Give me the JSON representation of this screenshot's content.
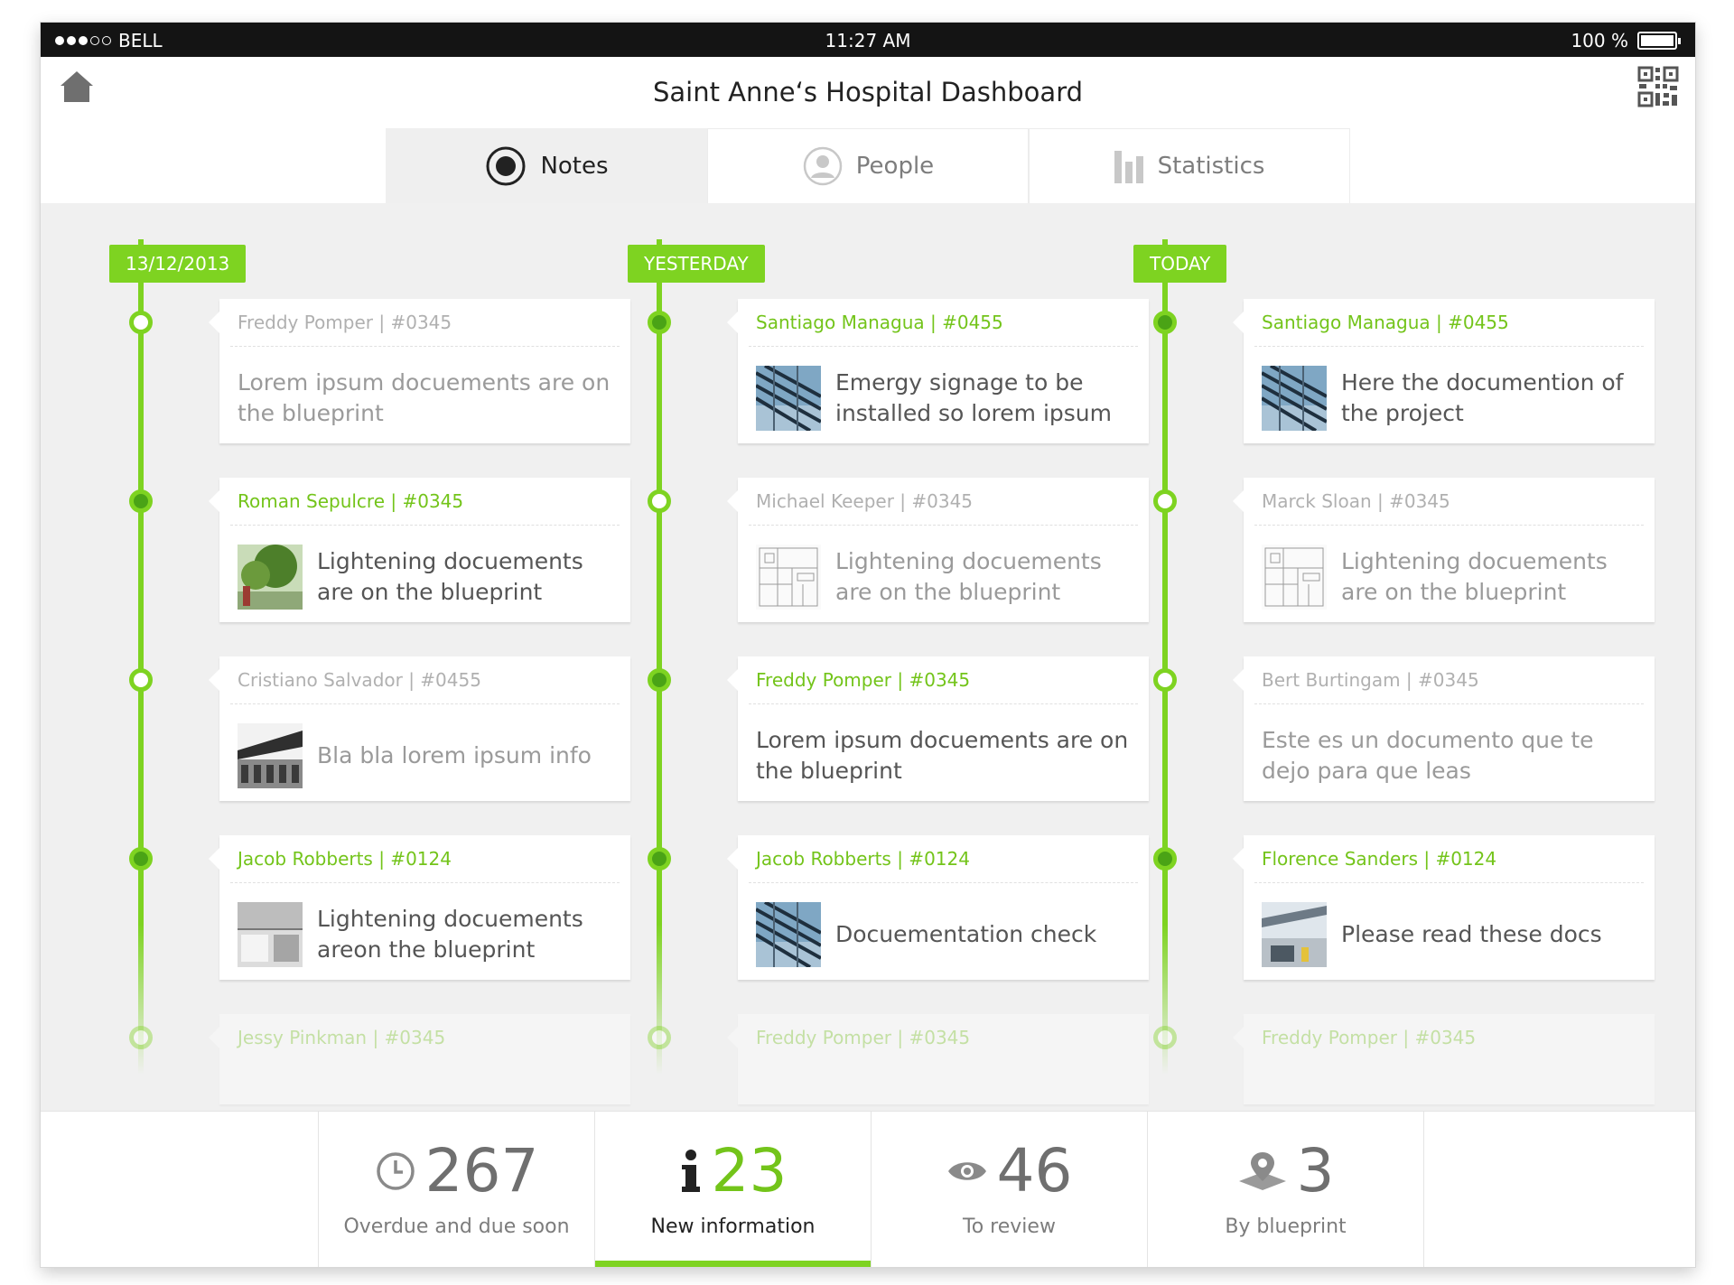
{
  "status_bar": {
    "carrier": "BELL",
    "time": "11:27 AM",
    "battery": "100 %"
  },
  "header": {
    "title": "Saint Anne‘s Hospital Dashboard",
    "home_icon": "home-icon",
    "qr_icon": "qr-code-icon"
  },
  "tabs": [
    {
      "label": "Notes",
      "icon": "radio-icon",
      "active": true
    },
    {
      "label": "People",
      "icon": "person-icon",
      "active": false
    },
    {
      "label": "Statistics",
      "icon": "bar-chart-icon",
      "active": false
    }
  ],
  "columns": [
    {
      "date": "13/12/2013",
      "cards": [
        {
          "meta": "Freddy Pomper | #0345",
          "text": "Lorem ipsum docuements are on the blueprint",
          "thumb": "",
          "highlight": false
        },
        {
          "meta": "Roman Sepulcre | #0345",
          "text": "Lightening docuements are on the blueprint",
          "thumb": "tree-thumbnail",
          "highlight": true
        },
        {
          "meta": "Cristiano Salvador | #0455",
          "text": "Bla bla lorem ipsum info",
          "thumb": "building-thumbnail",
          "highlight": false
        },
        {
          "meta": "Jacob Robberts | #0124",
          "text": "Lightening docuements areon the blueprint",
          "thumb": "interior-thumbnail",
          "highlight": true
        },
        {
          "meta": "Jessy Pinkman | #0345",
          "text": "",
          "thumb": "",
          "highlight": true
        }
      ]
    },
    {
      "date": "YESTERDAY",
      "cards": [
        {
          "meta": "Santiago Managua | #0455",
          "text": "Emergy signage to be installed so lorem ipsum",
          "thumb": "roof-thumbnail",
          "highlight": true
        },
        {
          "meta": "Michael Keeper | #0345",
          "text": "Lightening docuements are on the blueprint",
          "thumb": "blueprint-thumbnail",
          "highlight": false
        },
        {
          "meta": "Freddy Pomper | #0345",
          "text": "Lorem ipsum docuements are on the blueprint",
          "thumb": "",
          "highlight": true
        },
        {
          "meta": "Jacob Robberts | #0124",
          "text": "Docuementation check",
          "thumb": "roof-thumbnail",
          "highlight": true
        },
        {
          "meta": "Freddy Pomper | #0345",
          "text": "",
          "thumb": "",
          "highlight": true
        }
      ]
    },
    {
      "date": "TODAY",
      "cards": [
        {
          "meta": "Santiago Managua | #0455",
          "text": "Here the documention of the project",
          "thumb": "roof-thumbnail",
          "highlight": true
        },
        {
          "meta": "Marck Sloan | #0345",
          "text": "Lightening docuements are on the blueprint",
          "thumb": "blueprint-thumbnail",
          "highlight": false
        },
        {
          "meta": "Bert Burtingam | #0345",
          "text": "Este es un documento que te dejo para que leas",
          "thumb": "",
          "highlight": false
        },
        {
          "meta": "Florence Sanders | #0124",
          "text": "Please read these docs",
          "thumb": "facade-thumbnail",
          "highlight": true
        },
        {
          "meta": "Freddy Pomper | #0345",
          "text": "",
          "thumb": "",
          "highlight": true
        }
      ]
    }
  ],
  "stats": [
    {
      "value": "267",
      "label": "Overdue and due soon",
      "icon": "clock-icon",
      "active": false
    },
    {
      "value": "23",
      "label": "New information",
      "icon": "info-icon",
      "active": true
    },
    {
      "value": "46",
      "label": "To review",
      "icon": "eye-icon",
      "active": false
    },
    {
      "value": "3",
      "label": "By blueprint",
      "icon": "map-pin-icon",
      "active": false
    }
  ],
  "colors": {
    "accent": "#7ed321",
    "accent_text": "#73c41a",
    "status_bar": "#141414",
    "background": "#f0f0f0"
  }
}
